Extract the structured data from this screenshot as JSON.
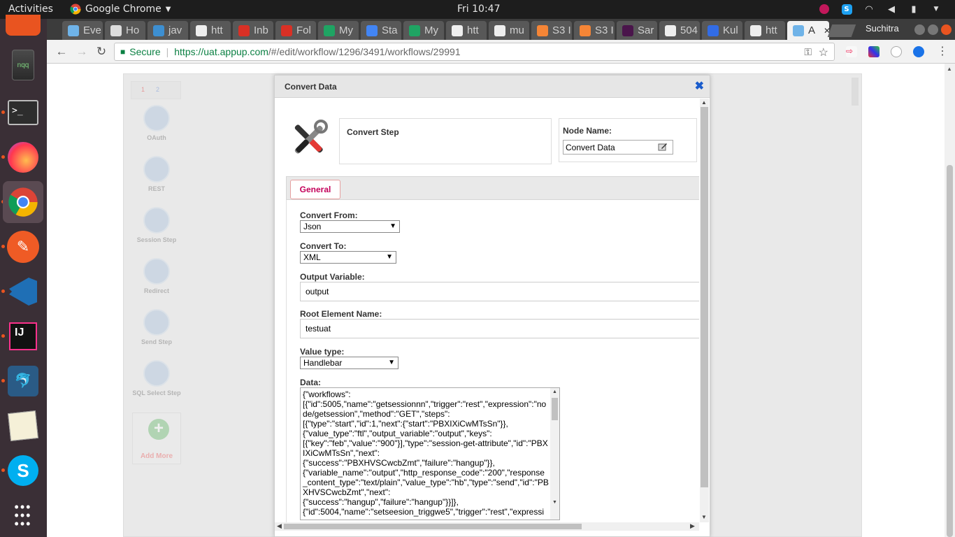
{
  "system_bar": {
    "activities": "Activities",
    "app_name": "Google Chrome",
    "clock": "Fri 10:47"
  },
  "browser": {
    "tabs": [
      {
        "label": "Eve",
        "icon": "cloud-icon",
        "color": "#6fb3e8"
      },
      {
        "label": "Ho",
        "icon": "openai-icon",
        "color": "#dddddd"
      },
      {
        "label": "jav",
        "icon": "qa-icon",
        "color": "#3d8fd1"
      },
      {
        "label": "htt",
        "icon": "page-icon",
        "color": "#eeeeee"
      },
      {
        "label": "Inb",
        "icon": "gmail-icon",
        "color": "#d93025"
      },
      {
        "label": "Fol",
        "icon": "gmail-icon",
        "color": "#d93025"
      },
      {
        "label": "My",
        "icon": "drive-icon",
        "color": "#1fa463"
      },
      {
        "label": "Sta",
        "icon": "docs-icon",
        "color": "#4285f4"
      },
      {
        "label": "My",
        "icon": "drive-icon",
        "color": "#1fa463"
      },
      {
        "label": "htt",
        "icon": "page-icon",
        "color": "#eeeeee"
      },
      {
        "label": "mu",
        "icon": "page-icon",
        "color": "#eeeeee"
      },
      {
        "label": "S3 I",
        "icon": "aws-icon",
        "color": "#f58536"
      },
      {
        "label": "S3 I",
        "icon": "aws-icon",
        "color": "#f58536"
      },
      {
        "label": "Sar",
        "icon": "slack-icon",
        "color": "#4a154b"
      },
      {
        "label": "504",
        "icon": "page-icon",
        "color": "#eeeeee"
      },
      {
        "label": "Kul",
        "icon": "kubernetes-icon",
        "color": "#326ce5"
      },
      {
        "label": "htt",
        "icon": "page-icon",
        "color": "#eeeeee"
      },
      {
        "label": "A",
        "icon": "cloud-icon",
        "color": "#6fb3e8",
        "active": true
      }
    ],
    "profile_name": "Suchitra",
    "address": {
      "secure_label": "Secure",
      "host": "https://uat.appup.com",
      "path": "/#/edit/workflow/1296/3491/workflows/29991"
    }
  },
  "palette": {
    "tabs": [
      "1",
      "2"
    ],
    "items": [
      "OAuth",
      "REST",
      "Session Step",
      "Redirect",
      "Send Step",
      "SQL Select Step"
    ],
    "add_more": "Add More"
  },
  "dialog": {
    "title": "Convert Data",
    "step_type": "Convert Step",
    "node_name_label": "Node Name:",
    "node_name_value": "Convert Data",
    "tabs": [
      "General"
    ],
    "form": {
      "convert_from_label": "Convert From:",
      "convert_from_value": "Json",
      "convert_to_label": "Convert To:",
      "convert_to_value": "XML",
      "output_variable_label": "Output Variable:",
      "output_variable_value": "output",
      "root_element_label": "Root Element Name:",
      "root_element_value": "testuat",
      "value_type_label": "Value type:",
      "value_type_value": "Handlebar",
      "data_label": "Data:",
      "data_value": "{\"workflows\":\n[{\"id\":5005,\"name\":\"getsessionnn\",\"trigger\":\"rest\",\"expression\":\"node/getsession\",\"method\":\"GET\",\"steps\":\n[{\"type\":\"start\",\"id\":1,\"next\":{\"start\":\"PBXIXiCwMTsSn\"}},\n{\"value_type\":\"ftl\",\"output_variable\":\"output\",\"keys\":\n[{\"key\":\"feb\",\"value\":\"900\"}],\"type\":\"session-get-attribute\",\"id\":\"PBXIXiCwMTsSn\",\"next\":\n{\"success\":\"PBXHVSCwcbZmt\",\"failure\":\"hangup\"}},\n{\"variable_name\":\"output\",\"http_response_code\":\"200\",\"response_content_type\":\"text/plain\",\"value_type\":\"hb\",\"type\":\"send\",\"id\":\"PBXHVSCwcbZmt\",\"next\":\n{\"success\":\"hangup\",\"failure\":\"hangup\"}}]},\n{\"id\":5004,\"name\":\"setseesion_triggwe5\",\"trigger\":\"rest\",\"expressi"
    }
  }
}
